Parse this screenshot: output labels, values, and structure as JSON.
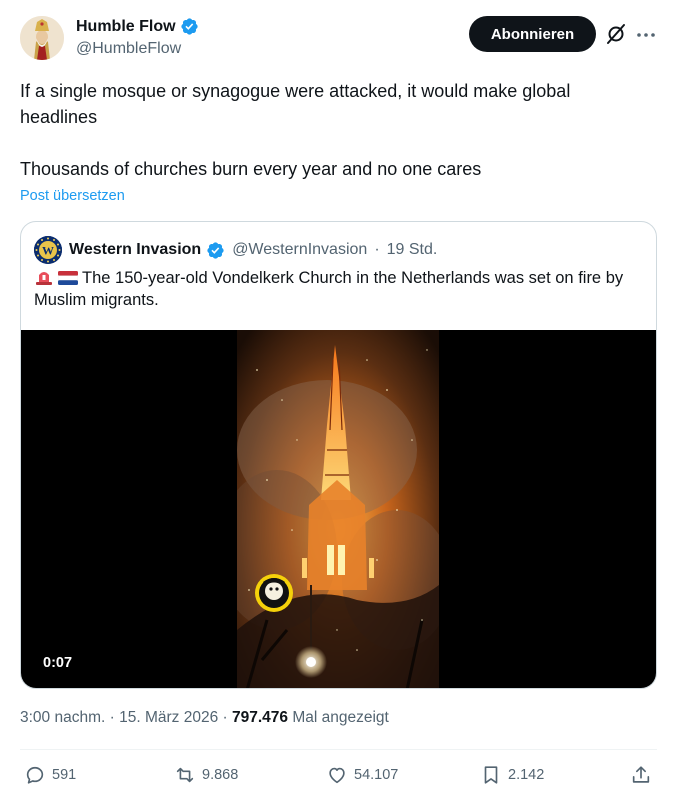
{
  "author": {
    "name": "Humble Flow",
    "handle": "@HumbleFlow",
    "verified": true
  },
  "follow_button_label": "Abonnieren",
  "tweet": {
    "line1": "If a single mosque or synagogue were attacked, it would make global headlines",
    "line2": "Thousands of churches burn every year and no one cares",
    "translate_label": "Post übersetzen"
  },
  "quoted": {
    "name": "Western Invasion",
    "handle": "@WesternInvasion",
    "separator": "·",
    "time": "19 Std.",
    "text": "The 150-year-old Vondelkerk Church in the Netherlands was set on fire by Muslim migrants.",
    "video_duration": "0:07"
  },
  "meta": {
    "time": "3:00 nachm.",
    "sep1": "·",
    "date": "15. März 2026",
    "sep2": "·",
    "views_count": "797.476",
    "views_label": "Mal angezeigt"
  },
  "actions": {
    "replies": "591",
    "reposts": "9.868",
    "likes": "54.107",
    "bookmarks": "2.142"
  },
  "colors": {
    "accent": "#1d9bf0",
    "text": "#0f1419",
    "secondary": "#536471",
    "border": "#cfd9de"
  }
}
